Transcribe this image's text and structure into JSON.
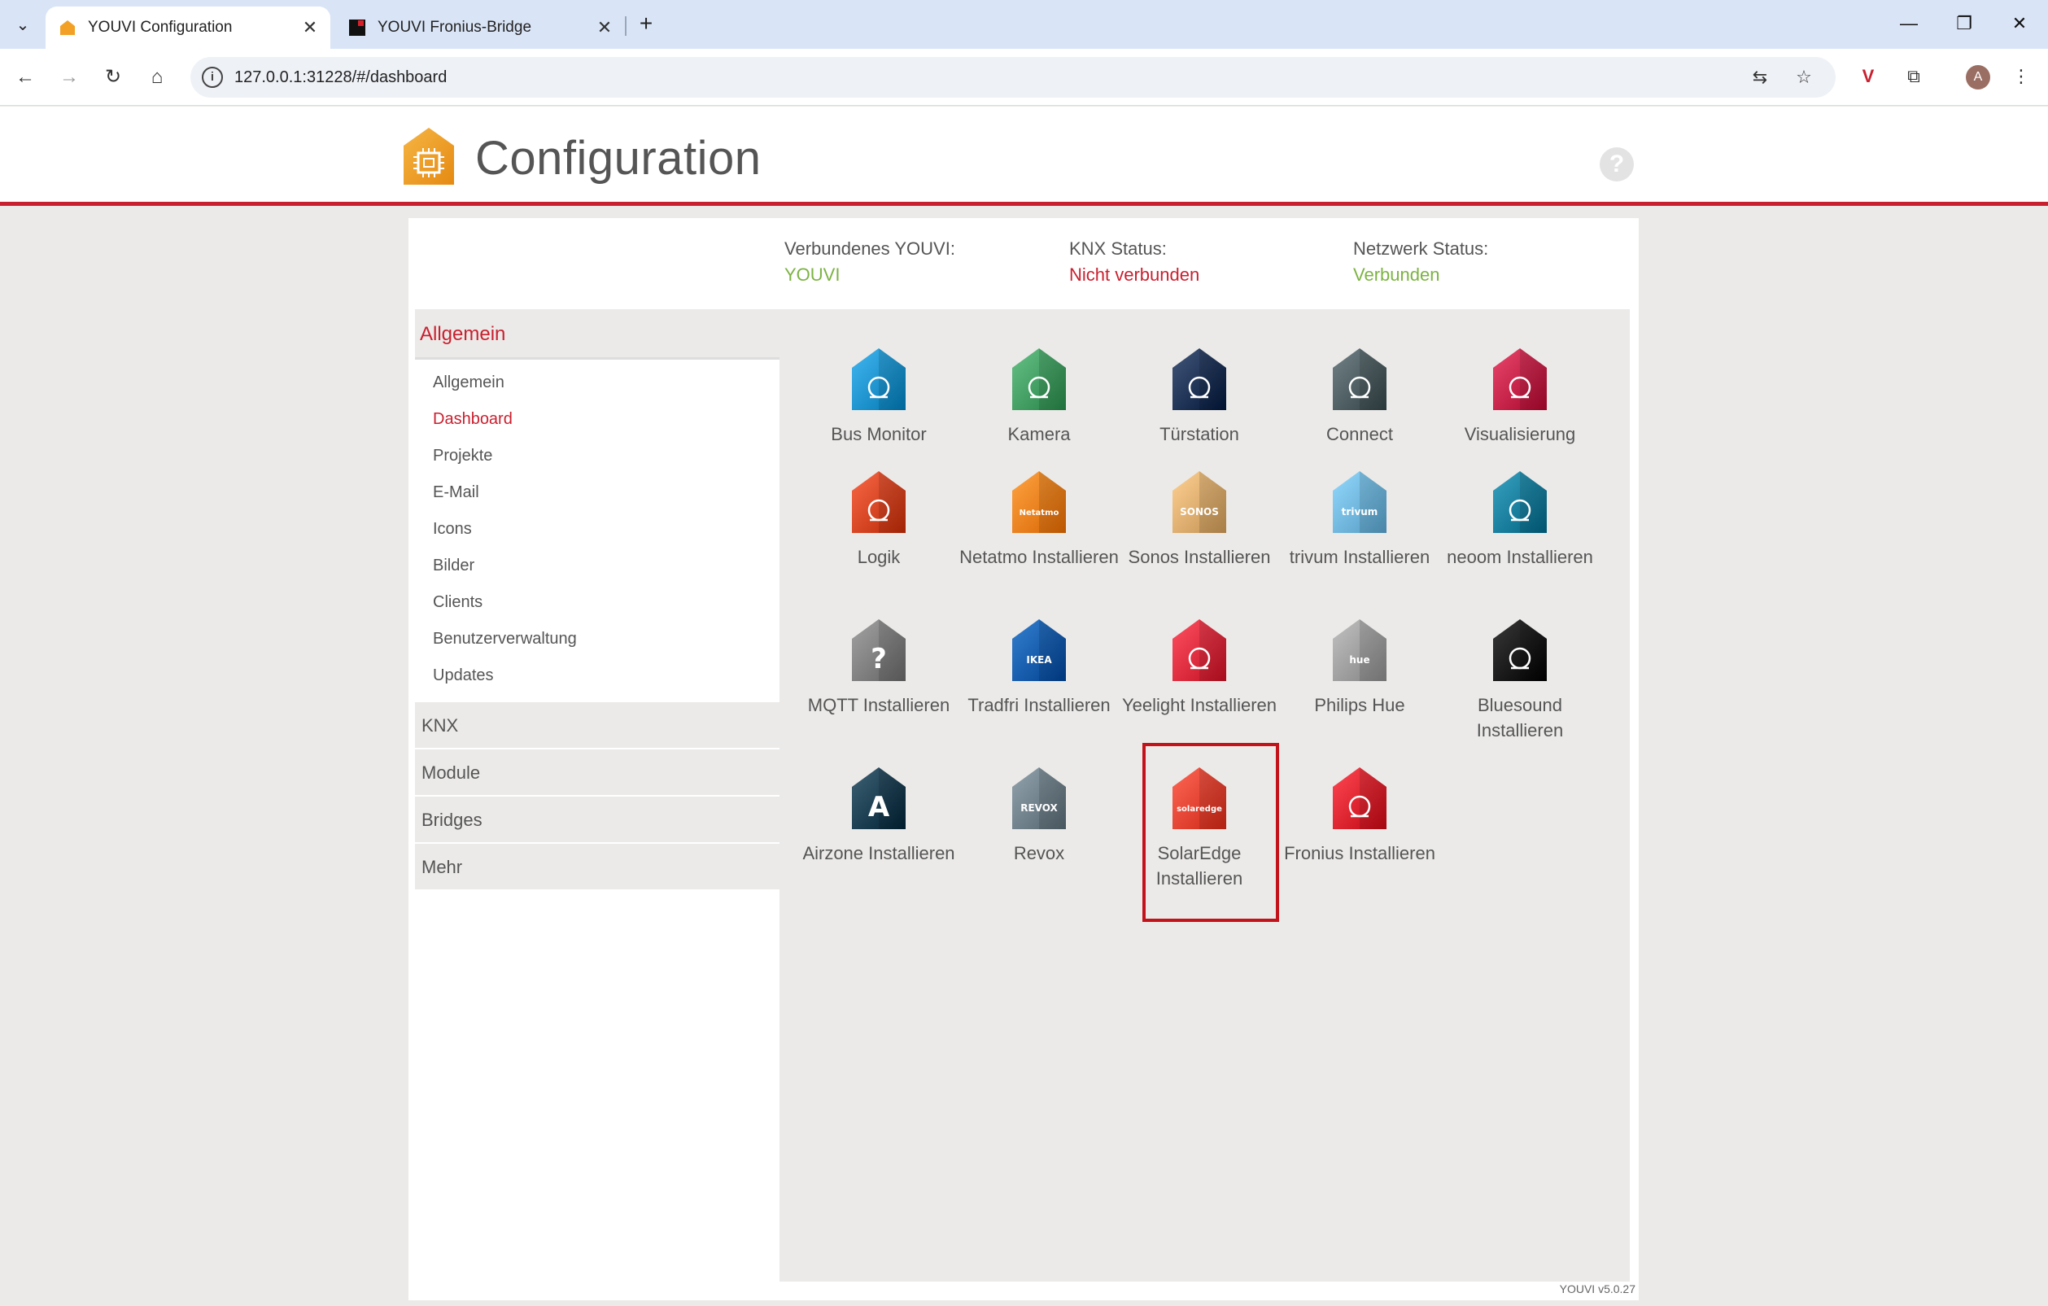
{
  "browser": {
    "tabs": [
      {
        "title": "YOUVI Configuration",
        "active": true
      },
      {
        "title": "YOUVI Fronius-Bridge",
        "active": false
      }
    ],
    "url": "127.0.0.1:31228/#/dashboard",
    "profile_initial": "A"
  },
  "header": {
    "title": "Configuration",
    "help": "?"
  },
  "status": {
    "youvi_label": "Verbundenes YOUVI:",
    "youvi_value": "YOUVI",
    "knx_label": "KNX Status:",
    "knx_value": "Nicht verbunden",
    "network_label": "Netzwerk Status:",
    "network_value": "Verbunden"
  },
  "sidebar": {
    "head": "Allgemein",
    "items": [
      "Allgemein",
      "Dashboard",
      "Projekte",
      "E-Mail",
      "Icons",
      "Bilder",
      "Clients",
      "Benutzerverwaltung",
      "Updates"
    ],
    "active_item": "Dashboard",
    "sections": [
      "KNX",
      "Module",
      "Bridges",
      "Mehr"
    ]
  },
  "tiles": [
    {
      "label": "Bus Monitor",
      "icon": "monitor-icon",
      "color": "#1a8fc9"
    },
    {
      "label": "Kamera",
      "icon": "camera-icon",
      "color": "#3e9a5e"
    },
    {
      "label": "Türstation",
      "icon": "door-station-icon",
      "color": "#1b2f52"
    },
    {
      "label": "Connect",
      "icon": "connect-icon",
      "color": "#4a5a5e"
    },
    {
      "label": "Visualisierung",
      "icon": "visualization-icon",
      "color": "#c21f45"
    },
    {
      "label": "Logik",
      "icon": "logic-icon",
      "color": "#d2411f"
    },
    {
      "label": "Netatmo Installieren",
      "icon": "netatmo-icon",
      "color": "#f07c1a"
    },
    {
      "label": "Sonos Installieren",
      "icon": "sonos-icon",
      "color": "#d9a96a"
    },
    {
      "label": "trivum Installieren",
      "icon": "trivum-icon",
      "color": "#6cb2d9"
    },
    {
      "label": "neoom Installieren",
      "icon": "neoom-icon",
      "color": "#117a99"
    },
    {
      "label": "MQTT Installieren",
      "icon": "mqtt-icon",
      "color": "#7b7b7b"
    },
    {
      "label": "Tradfri Installieren",
      "icon": "ikea-icon",
      "color": "#0c58a8"
    },
    {
      "label": "Yeelight Installieren",
      "icon": "yeelight-icon",
      "color": "#d9283a"
    },
    {
      "label": "Philips Hue",
      "icon": "hue-icon",
      "color": "#9a9a9a"
    },
    {
      "label": "Bluesound Installieren",
      "icon": "bluesound-icon",
      "color": "#111111"
    },
    {
      "label": "Airzone Installieren",
      "icon": "airzone-icon",
      "color": "#173a4d"
    },
    {
      "label": "Revox",
      "icon": "revox-icon",
      "color": "#6c7c86"
    },
    {
      "label": "SolarEdge Installieren",
      "icon": "solaredge-icon",
      "color": "#e53f2e"
    },
    {
      "label": "Fronius Installieren",
      "icon": "fronius-icon",
      "color": "#d8202b"
    }
  ],
  "highlighted_tile": "SolarEdge Installieren",
  "icon_glyphs": {
    "MQTT Installieren": "?",
    "Tradfri Installieren": "IKEA",
    "Sonos Installieren": "SONOS",
    "trivum Installieren": "trivum",
    "Philips Hue": "hue",
    "Airzone Installieren": "A",
    "Revox": "REVOX",
    "Netatmo Installieren": "Netatmo",
    "SolarEdge Installieren": "solaredge"
  },
  "version": "YOUVI v5.0.27",
  "colors": {
    "brand_red": "#c9202f",
    "status_green": "#7cb342"
  }
}
